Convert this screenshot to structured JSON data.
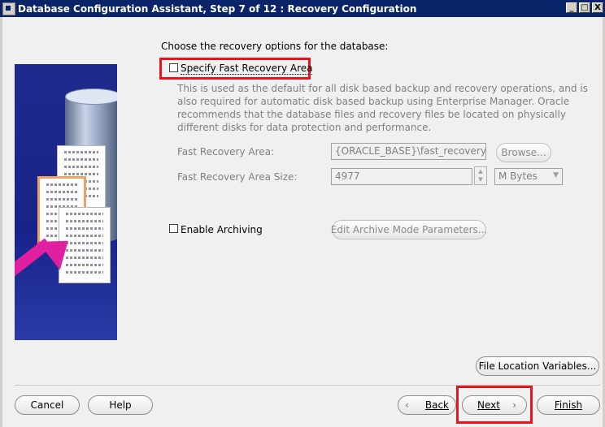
{
  "window": {
    "title": "Database Configuration Assistant, Step 7 of 12 : Recovery Configuration",
    "minimize": "_",
    "maximize": "□",
    "close": "X"
  },
  "heading": "Choose the recovery options for the database:",
  "fast_recovery": {
    "checkbox_label": "Specify Fast Recovery Area",
    "checked": false,
    "description": "This is used as the default for all disk based backup and recovery operations, and is also required for automatic disk based backup using Enterprise Manager. Oracle recommends that the database files and recovery files be located on physically different disks for data protection and performance.",
    "area_label": "Fast Recovery Area:",
    "area_value": "{ORACLE_BASE}\\fast_recovery_ar",
    "browse_label": "Browse...",
    "size_label": "Fast Recovery Area Size:",
    "size_value": "4977",
    "unit_value": "M Bytes"
  },
  "archiving": {
    "checkbox_label": "Enable Archiving",
    "checked": false,
    "edit_params_label": "Edit Archive Mode Parameters..."
  },
  "buttons": {
    "file_location_variables": "File Location Variables...",
    "cancel": "Cancel",
    "help": "Help",
    "back": "Back",
    "next": "Next",
    "finish": "Finish"
  },
  "colors": {
    "highlight": "#e8141e",
    "titlebar": "#0a246a",
    "illustration_bg": "#1e2b8c",
    "arrow": "#e020a0"
  }
}
